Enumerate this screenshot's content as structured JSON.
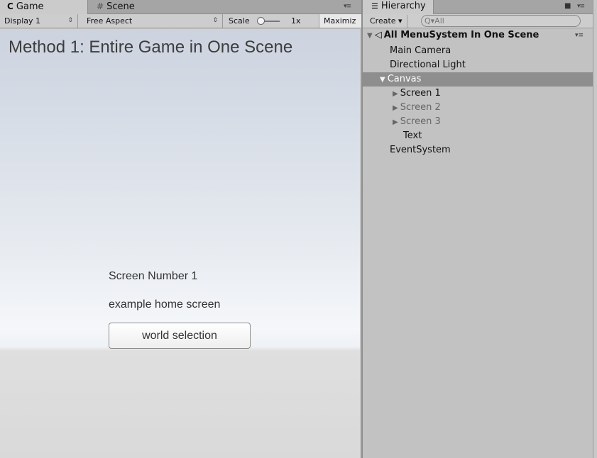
{
  "game_panel": {
    "tabs": [
      {
        "label": "Game",
        "icon": "pacman-game-icon",
        "glyph": "C"
      },
      {
        "label": "Scene",
        "icon": "grid-icon",
        "glyph": "#"
      }
    ],
    "menu_glyph": "▾≡",
    "toolbar": {
      "display": "Display 1",
      "aspect": "Free Aspect",
      "scale_label": "Scale",
      "scale_value": "1x",
      "maximize": "Maximiz"
    },
    "viewport": {
      "title": "Method 1: Entire Game in One Scene",
      "screen_number": "Screen Number 1",
      "home_text": "example home screen",
      "button_label": "world selection"
    }
  },
  "hierarchy": {
    "tab_label": "Hierarchy",
    "tab_glyph": "☰",
    "lock_glyph": "🔒",
    "menu_glyph": "▾≡",
    "create_label": "Create ▾",
    "search_placeholder": "Q▾All",
    "scene": {
      "glyph": "◁",
      "label": "All MenuSystem In One Scene",
      "menu_glyph": "▾≡"
    },
    "items": [
      {
        "label": "Main Camera"
      },
      {
        "label": "Directional Light"
      },
      {
        "label": "Canvas"
      },
      {
        "label": "Screen 1"
      },
      {
        "label": "Screen 2"
      },
      {
        "label": "Screen 3"
      },
      {
        "label": "Text"
      },
      {
        "label": "EventSystem"
      }
    ],
    "selected": "Canvas"
  },
  "colors": {
    "panel_bg": "#c2c2c2",
    "tab_bg": "#a5a5a5",
    "selected_row": "#8e8e8e"
  }
}
